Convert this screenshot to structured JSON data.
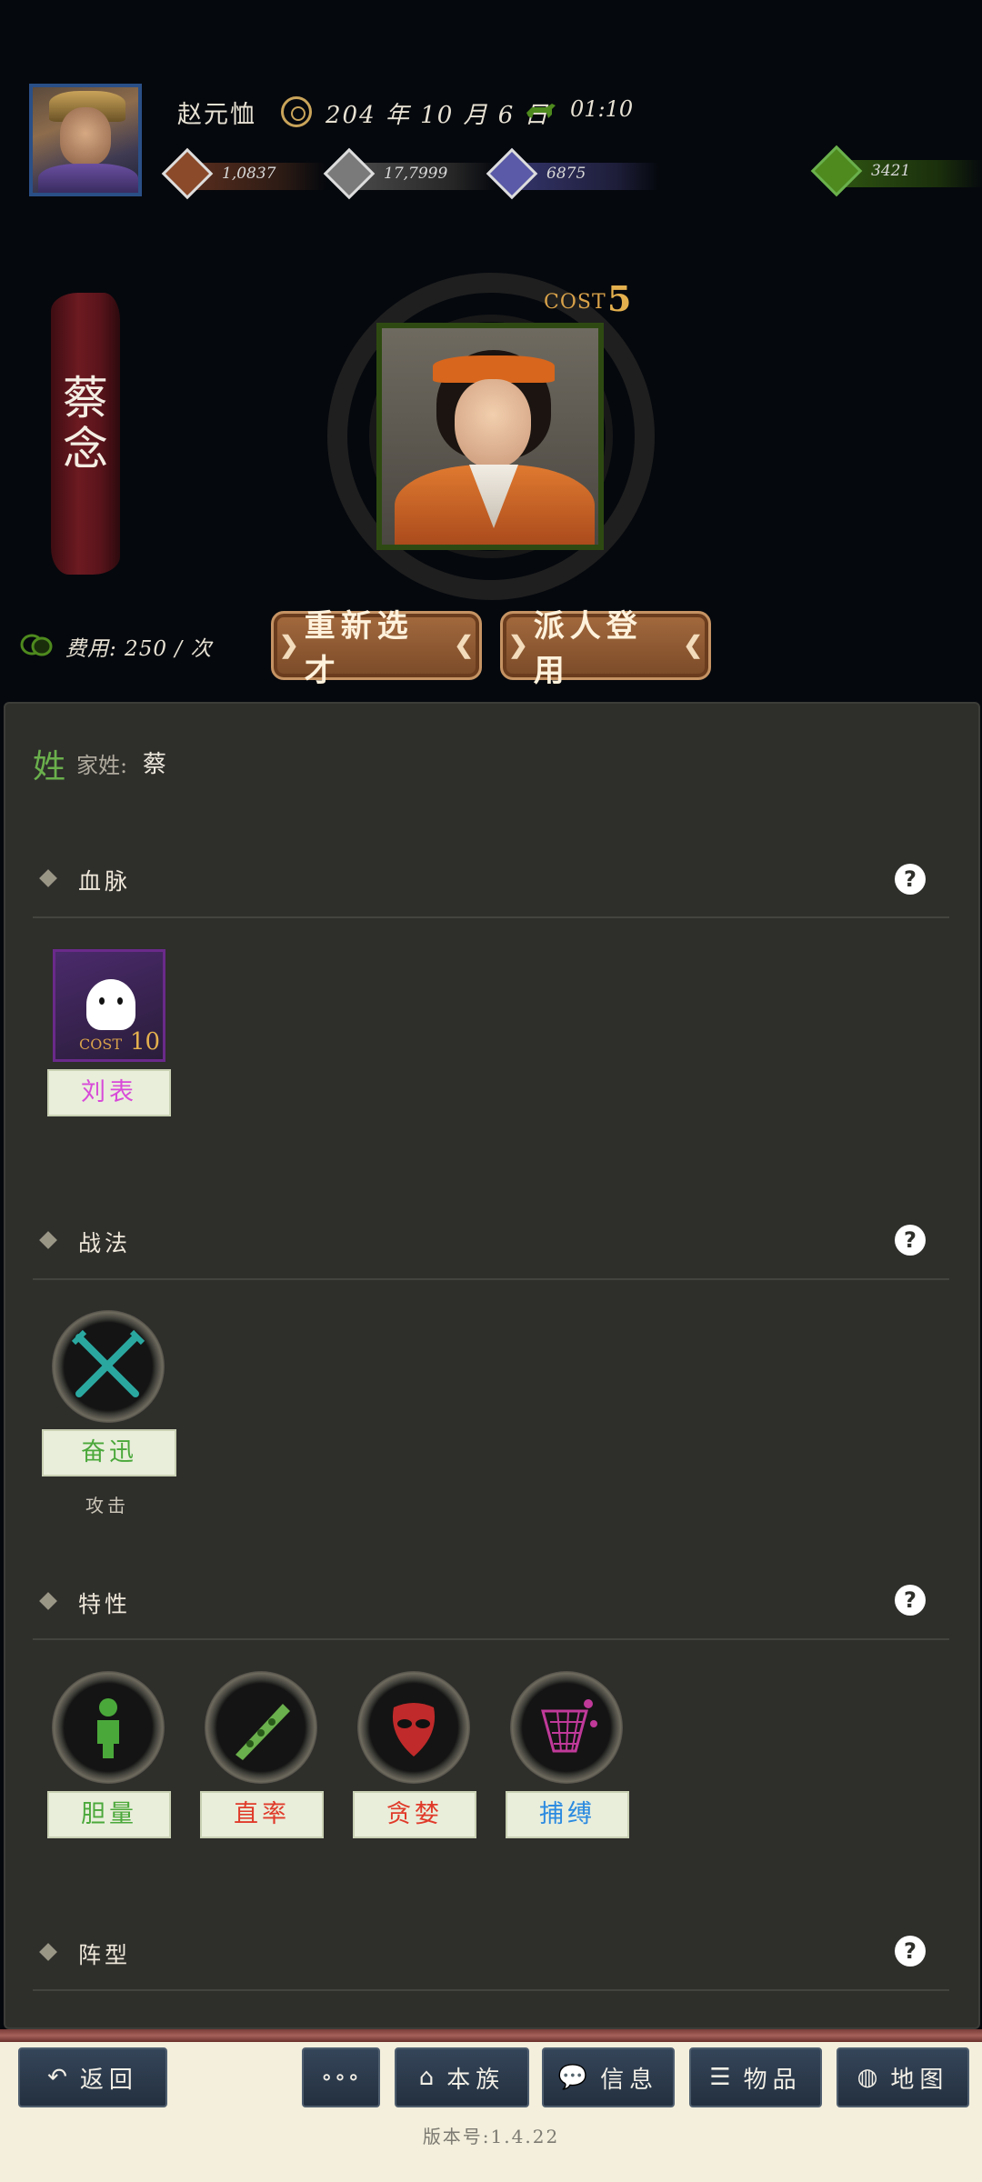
{
  "header": {
    "lord_name": "赵元恤",
    "date": "204 年 10 月 6 日",
    "time": "01:10",
    "resources": [
      {
        "icon": "coin-icon",
        "value": "1,0837",
        "color": "#8b4a2a"
      },
      {
        "icon": "grain-icon",
        "value": "17,7999",
        "color": "#7a7a7a"
      },
      {
        "icon": "soldier-icon",
        "value": "6875",
        "color": "#5a5aa8"
      },
      {
        "icon": "money-bag-icon",
        "value": "3421",
        "color": "#4e8a1e"
      }
    ]
  },
  "hero": {
    "name": "蔡念",
    "cost_label": "COST",
    "cost_value": "5",
    "fee_text": "费用: 250 / 次",
    "reselect_label": "重新选才",
    "recruit_label": "派人登用"
  },
  "panel": {
    "surname_char": "姓",
    "surname_label": "家姓:",
    "surname_value": "蔡",
    "bloodline": {
      "title": "血脉",
      "card_cost_label": "COST",
      "card_cost_value": "10",
      "card_name": "刘表",
      "card_color": "#d84ad8"
    },
    "tactics": {
      "title": "战法",
      "skill_name": "奋迅",
      "skill_type": "攻击",
      "skill_color": "#4aa83a"
    },
    "traits": {
      "title": "特性",
      "items": [
        {
          "name": "胆量",
          "icon": "figure-icon",
          "color": "#4aa83a"
        },
        {
          "name": "直率",
          "icon": "pea-pod-icon",
          "color": "#e03a2a"
        },
        {
          "name": "贪婪",
          "icon": "mask-icon",
          "color": "#e03a2a"
        },
        {
          "name": "捕缚",
          "icon": "net-icon",
          "color": "#2a8ae0"
        }
      ]
    },
    "formation": {
      "title": "阵型"
    },
    "help_symbol": "?"
  },
  "nav": {
    "back": "返回",
    "more": "∘∘∘",
    "clan": "本族",
    "info": "信息",
    "items": "物品",
    "map": "地图"
  },
  "version": "版本号:1.4.22"
}
